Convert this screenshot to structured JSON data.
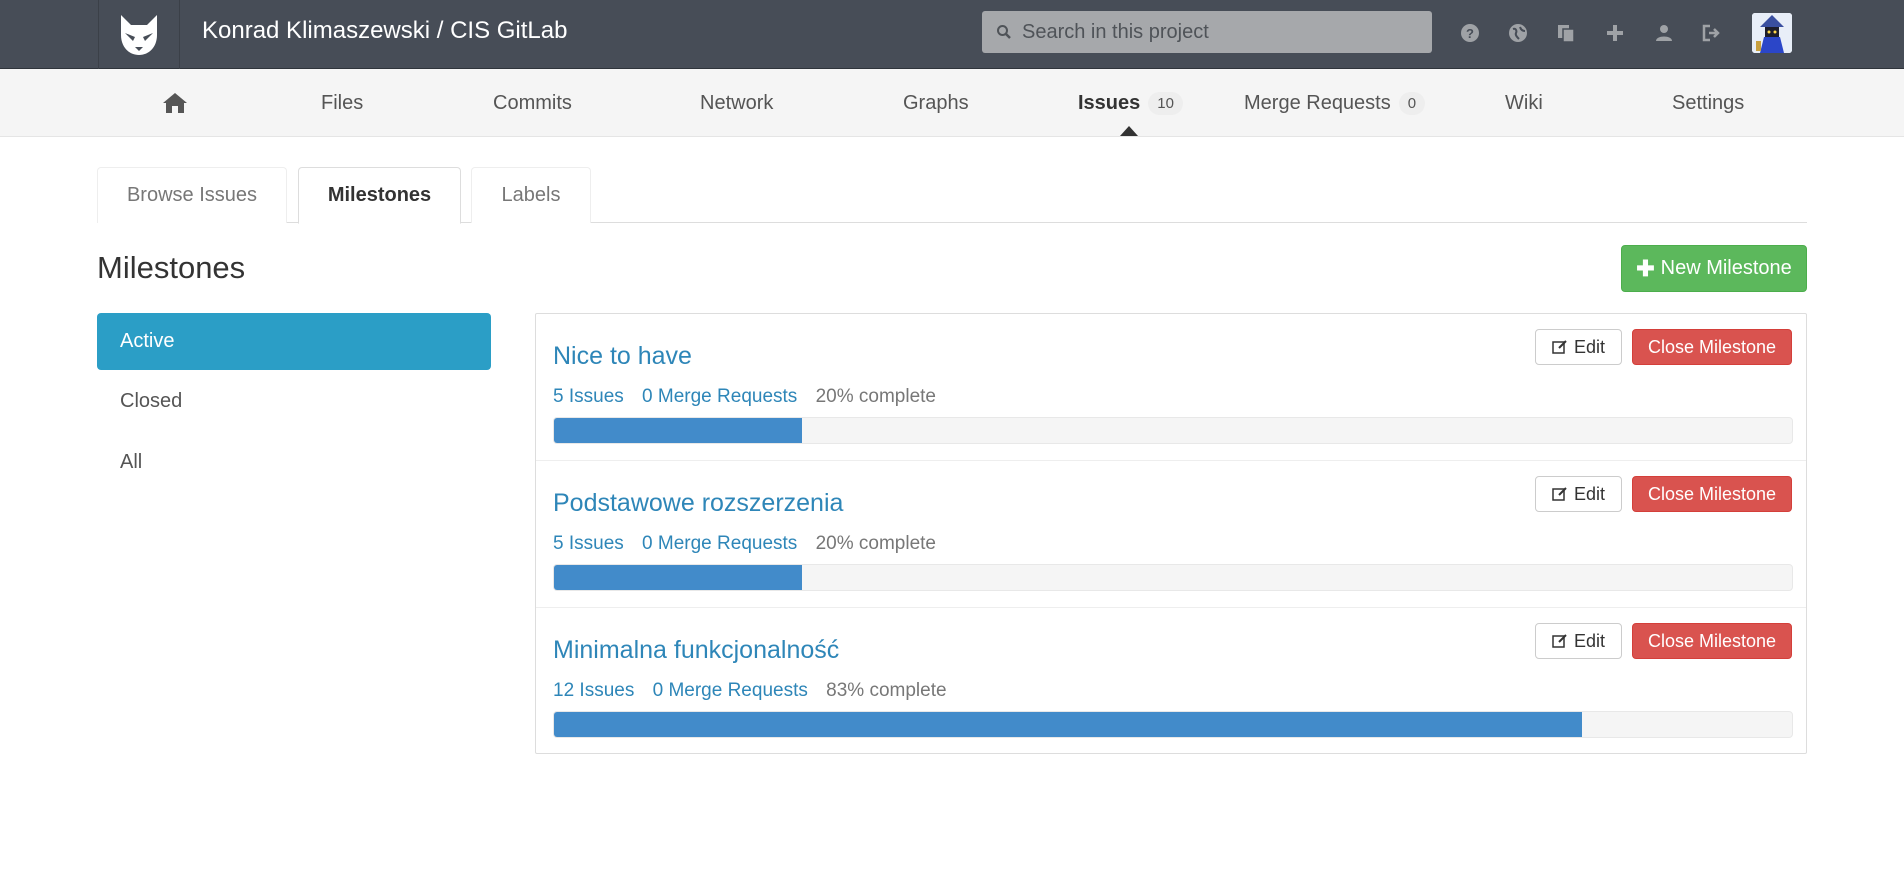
{
  "header": {
    "project_title": "Konrad Klimaszewski / CIS GitLab",
    "search_placeholder": "Search in this project",
    "icons": [
      "question-icon",
      "globe-icon",
      "copy-icon",
      "plus-icon",
      "user-icon",
      "sign-out-icon"
    ]
  },
  "nav": {
    "items": [
      {
        "label": "Files"
      },
      {
        "label": "Commits"
      },
      {
        "label": "Network"
      },
      {
        "label": "Graphs"
      },
      {
        "label": "Issues",
        "badge": "10"
      },
      {
        "label": "Merge Requests",
        "badge": "0"
      },
      {
        "label": "Wiki"
      },
      {
        "label": "Settings"
      }
    ]
  },
  "tabs": [
    "Browse Issues",
    "Milestones",
    "Labels"
  ],
  "page": {
    "title": "Milestones",
    "new_button": "New Milestone"
  },
  "filters": [
    "Active",
    "Closed",
    "All"
  ],
  "milestones": [
    {
      "title": "Nice to have",
      "issues": "5 Issues",
      "merge_requests": "0 Merge Requests",
      "complete": "20% complete",
      "progress": 0.2,
      "edit": "Edit",
      "close": "Close Milestone"
    },
    {
      "title": "Podstawowe rozszerzenia",
      "issues": "5 Issues",
      "merge_requests": "0 Merge Requests",
      "complete": "20% complete",
      "progress": 0.2,
      "edit": "Edit",
      "close": "Close Milestone"
    },
    {
      "title": "Minimalna funkcjonalność",
      "issues": "12 Issues",
      "merge_requests": "0 Merge Requests",
      "complete": "83% complete",
      "progress": 0.83,
      "edit": "Edit",
      "close": "Close Milestone"
    }
  ],
  "colors": {
    "header_bg": "#474d57",
    "active_filter": "#2b9ec6",
    "link": "#2e86b8",
    "progress": "#428bca",
    "success": "#5cb85c",
    "danger": "#d9534f"
  }
}
